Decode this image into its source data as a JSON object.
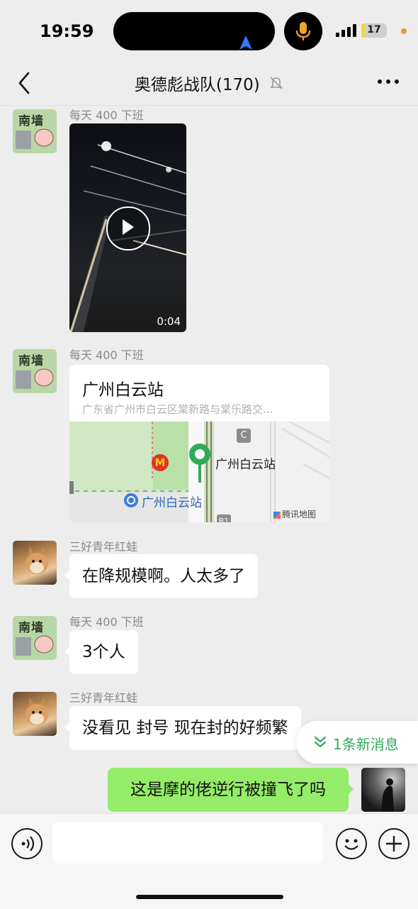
{
  "status_bar": {
    "time": "19:59",
    "battery": "17",
    "battery_level": 0.17
  },
  "header": {
    "title": "奥德彪战队(170)"
  },
  "messages": [
    {
      "sender": "每天 400 下班",
      "type": "video",
      "duration": "0:04"
    },
    {
      "sender": "每天 400 下班",
      "type": "location",
      "place_name": "广州白云站",
      "address": "广东省广州市白云区棠新路与棠乐路交...",
      "map_labels": {
        "station": "广州白云站",
        "station_marker": "广州白云站",
        "exit_c": "C",
        "exit_b1": "B1",
        "mcd": "M",
        "provider": "腾讯地图"
      }
    },
    {
      "sender": "三好青年红蛙",
      "type": "text",
      "text": "在降规模啊。人太多了"
    },
    {
      "sender": "每天 400 下班",
      "type": "text",
      "text": "3个人"
    },
    {
      "sender": "三好青年红蛙",
      "type": "text",
      "text": "没看见  封号 现在封的好频繁"
    },
    {
      "sender": "me",
      "type": "text",
      "text": "这是摩的佬逆行被撞飞了吗"
    }
  ],
  "avatars": {
    "nanqiang_chars": "南墙"
  },
  "new_messages_pill": {
    "label": "1条新消息"
  },
  "colors": {
    "accent_green": "#95ec69",
    "pill_green": "#2faa58",
    "background": "#ededed"
  }
}
